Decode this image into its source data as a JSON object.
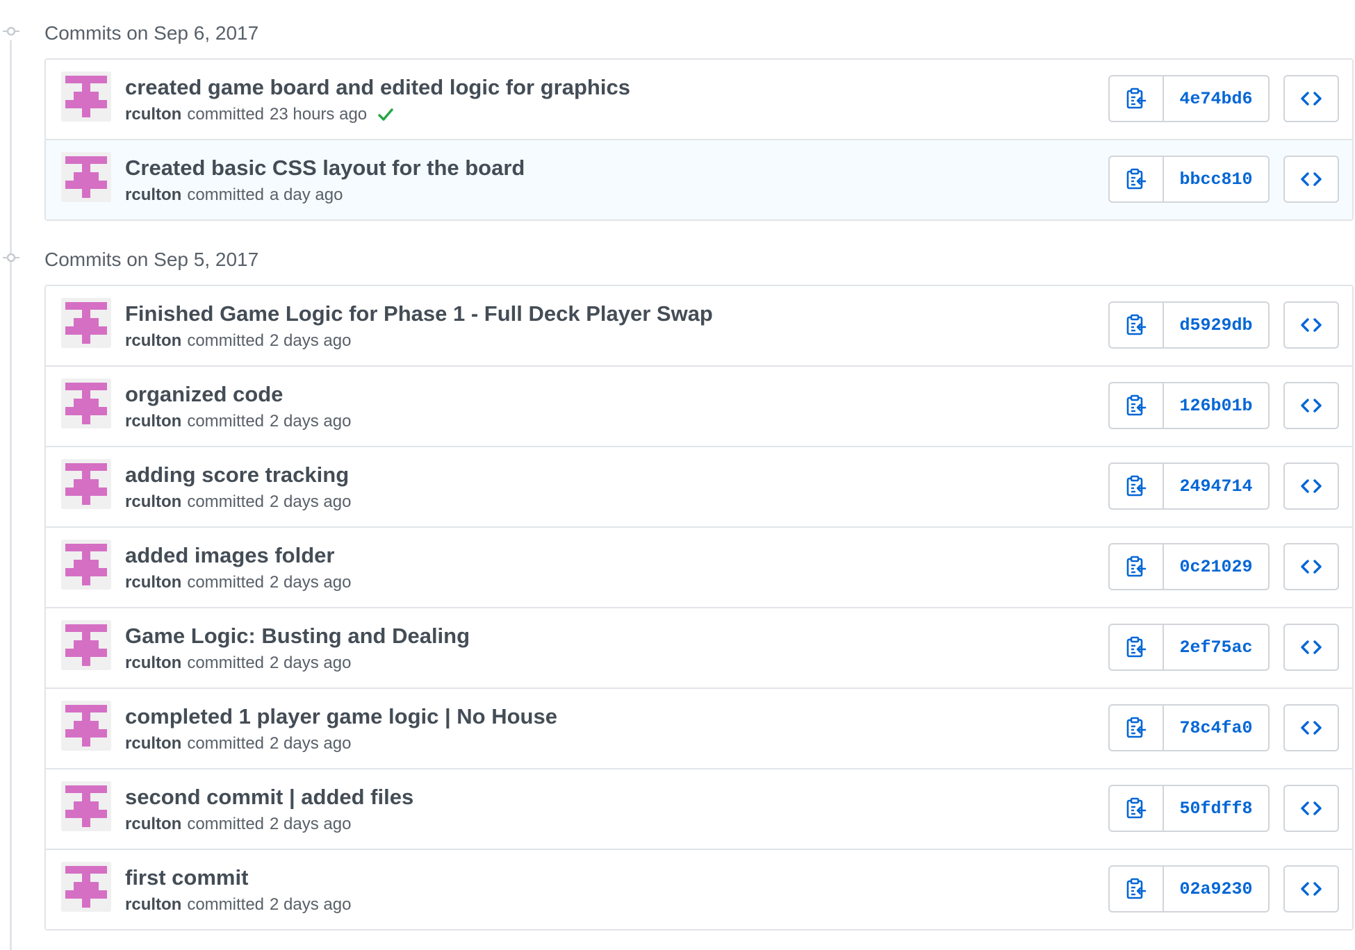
{
  "groups": [
    {
      "title": "Commits on Sep 6, 2017",
      "commits": [
        {
          "message": "created game board and edited logic for graphics",
          "author": "rculton",
          "verb": "committed",
          "time": "23 hours ago",
          "sha": "4e74bd6",
          "verified": true,
          "highlight": false
        },
        {
          "message": "Created basic CSS layout for the board",
          "author": "rculton",
          "verb": "committed",
          "time": "a day ago",
          "sha": "bbcc810",
          "verified": false,
          "highlight": true
        }
      ]
    },
    {
      "title": "Commits on Sep 5, 2017",
      "commits": [
        {
          "message": "Finished Game Logic for Phase 1 - Full Deck Player Swap",
          "author": "rculton",
          "verb": "committed",
          "time": "2 days ago",
          "sha": "d5929db",
          "verified": false,
          "highlight": false
        },
        {
          "message": "organized code",
          "author": "rculton",
          "verb": "committed",
          "time": "2 days ago",
          "sha": "126b01b",
          "verified": false,
          "highlight": false
        },
        {
          "message": "adding score tracking",
          "author": "rculton",
          "verb": "committed",
          "time": "2 days ago",
          "sha": "2494714",
          "verified": false,
          "highlight": false
        },
        {
          "message": "added images folder",
          "author": "rculton",
          "verb": "committed",
          "time": "2 days ago",
          "sha": "0c21029",
          "verified": false,
          "highlight": false
        },
        {
          "message": "Game Logic: Busting and Dealing",
          "author": "rculton",
          "verb": "committed",
          "time": "2 days ago",
          "sha": "2ef75ac",
          "verified": false,
          "highlight": false
        },
        {
          "message": "completed 1 player game logic | No House",
          "author": "rculton",
          "verb": "committed",
          "time": "2 days ago",
          "sha": "78c4fa0",
          "verified": false,
          "highlight": false
        },
        {
          "message": "second commit | added files",
          "author": "rculton",
          "verb": "committed",
          "time": "2 days ago",
          "sha": "50fdff8",
          "verified": false,
          "highlight": false
        },
        {
          "message": "first commit",
          "author": "rculton",
          "verb": "committed",
          "time": "2 days ago",
          "sha": "02a9230",
          "verified": false,
          "highlight": false
        }
      ]
    }
  ],
  "icons": {
    "group_marker": "git-commit-icon",
    "avatar": "identicon-avatar",
    "copy": "clippy-icon",
    "browse": "code-icon",
    "status": "check-icon"
  },
  "colors": {
    "identicon": "#d56fc4",
    "sha": "#0366d6",
    "check": "#28a745",
    "highlight_bg": "#f6fbff"
  }
}
